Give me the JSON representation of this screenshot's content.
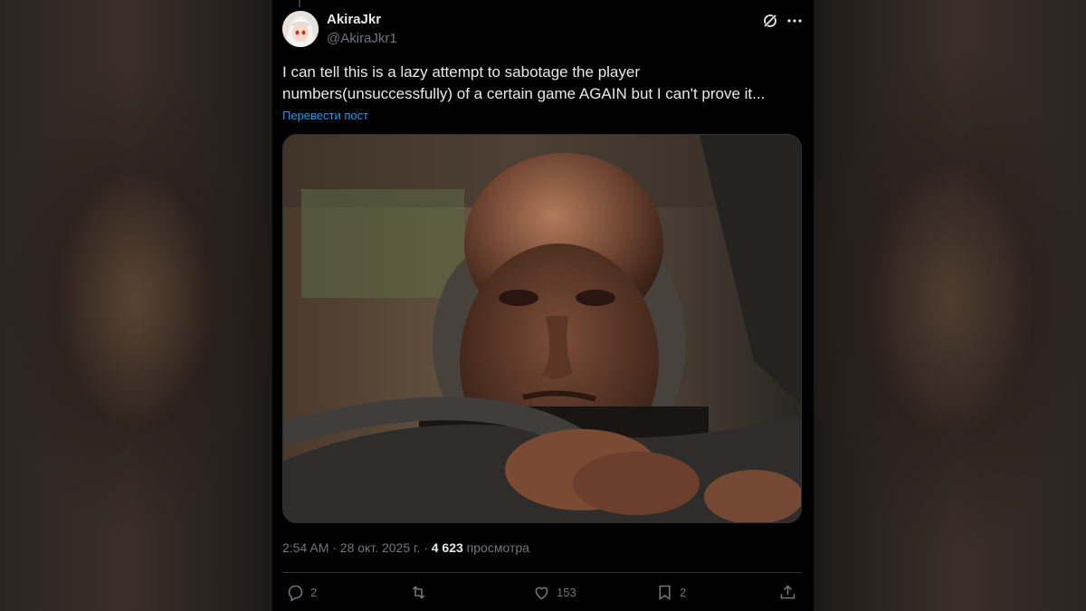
{
  "post": {
    "display_name": "AkiraJkr",
    "handle": "@AkiraJkr1",
    "text": "I can tell this is a lazy attempt to sabotage the player numbers(unsuccessfully) of a certain game AGAIN but I can't prove it...",
    "translate_label": "Перевести пост",
    "timestamp": "2:54 AM · 28 окт. 2025 г. · ",
    "views_count": "4 623",
    "views_label": " просмотра"
  },
  "actions": {
    "replies": "2",
    "reposts": "",
    "likes": "153",
    "bookmarks": "2"
  },
  "icons": {
    "header": [
      "grok-icon",
      "more-icon"
    ],
    "actions": [
      "reply-icon",
      "repost-icon",
      "like-icon",
      "bookmark-icon",
      "share-icon"
    ]
  },
  "colors": {
    "background": "#000000",
    "text": "#e7e9ea",
    "secondary": "#71767b",
    "link": "#1d9bf0"
  }
}
